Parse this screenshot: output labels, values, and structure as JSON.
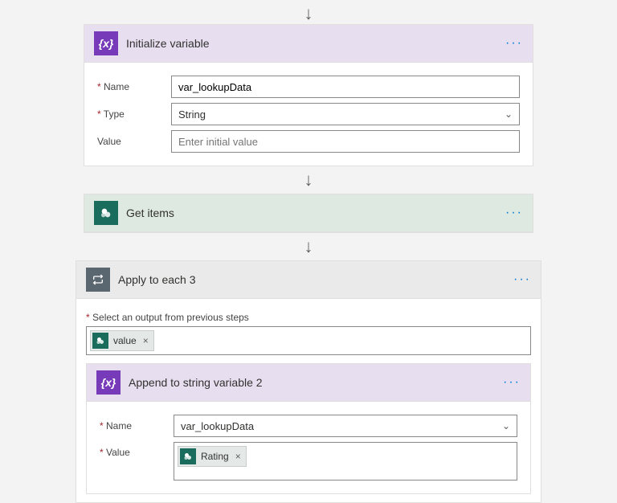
{
  "arrow_glyph": "↓",
  "more_glyph": "···",
  "chevron_glyph": "⌄",
  "x_glyph": "×",
  "var_glyph": "{x}",
  "step1": {
    "title": "Initialize variable",
    "name_label": "Name",
    "name_value": "var_lookupData",
    "type_label": "Type",
    "type_value": "String",
    "value_label": "Value",
    "value_placeholder": "Enter initial value"
  },
  "step2": {
    "title": "Get items"
  },
  "step3": {
    "title": "Apply to each 3",
    "select_label": "Select an output from previous steps",
    "token": "value",
    "inner": {
      "title": "Append to string variable 2",
      "name_label": "Name",
      "name_value": "var_lookupData",
      "value_label": "Value",
      "value_token": "Rating"
    }
  }
}
